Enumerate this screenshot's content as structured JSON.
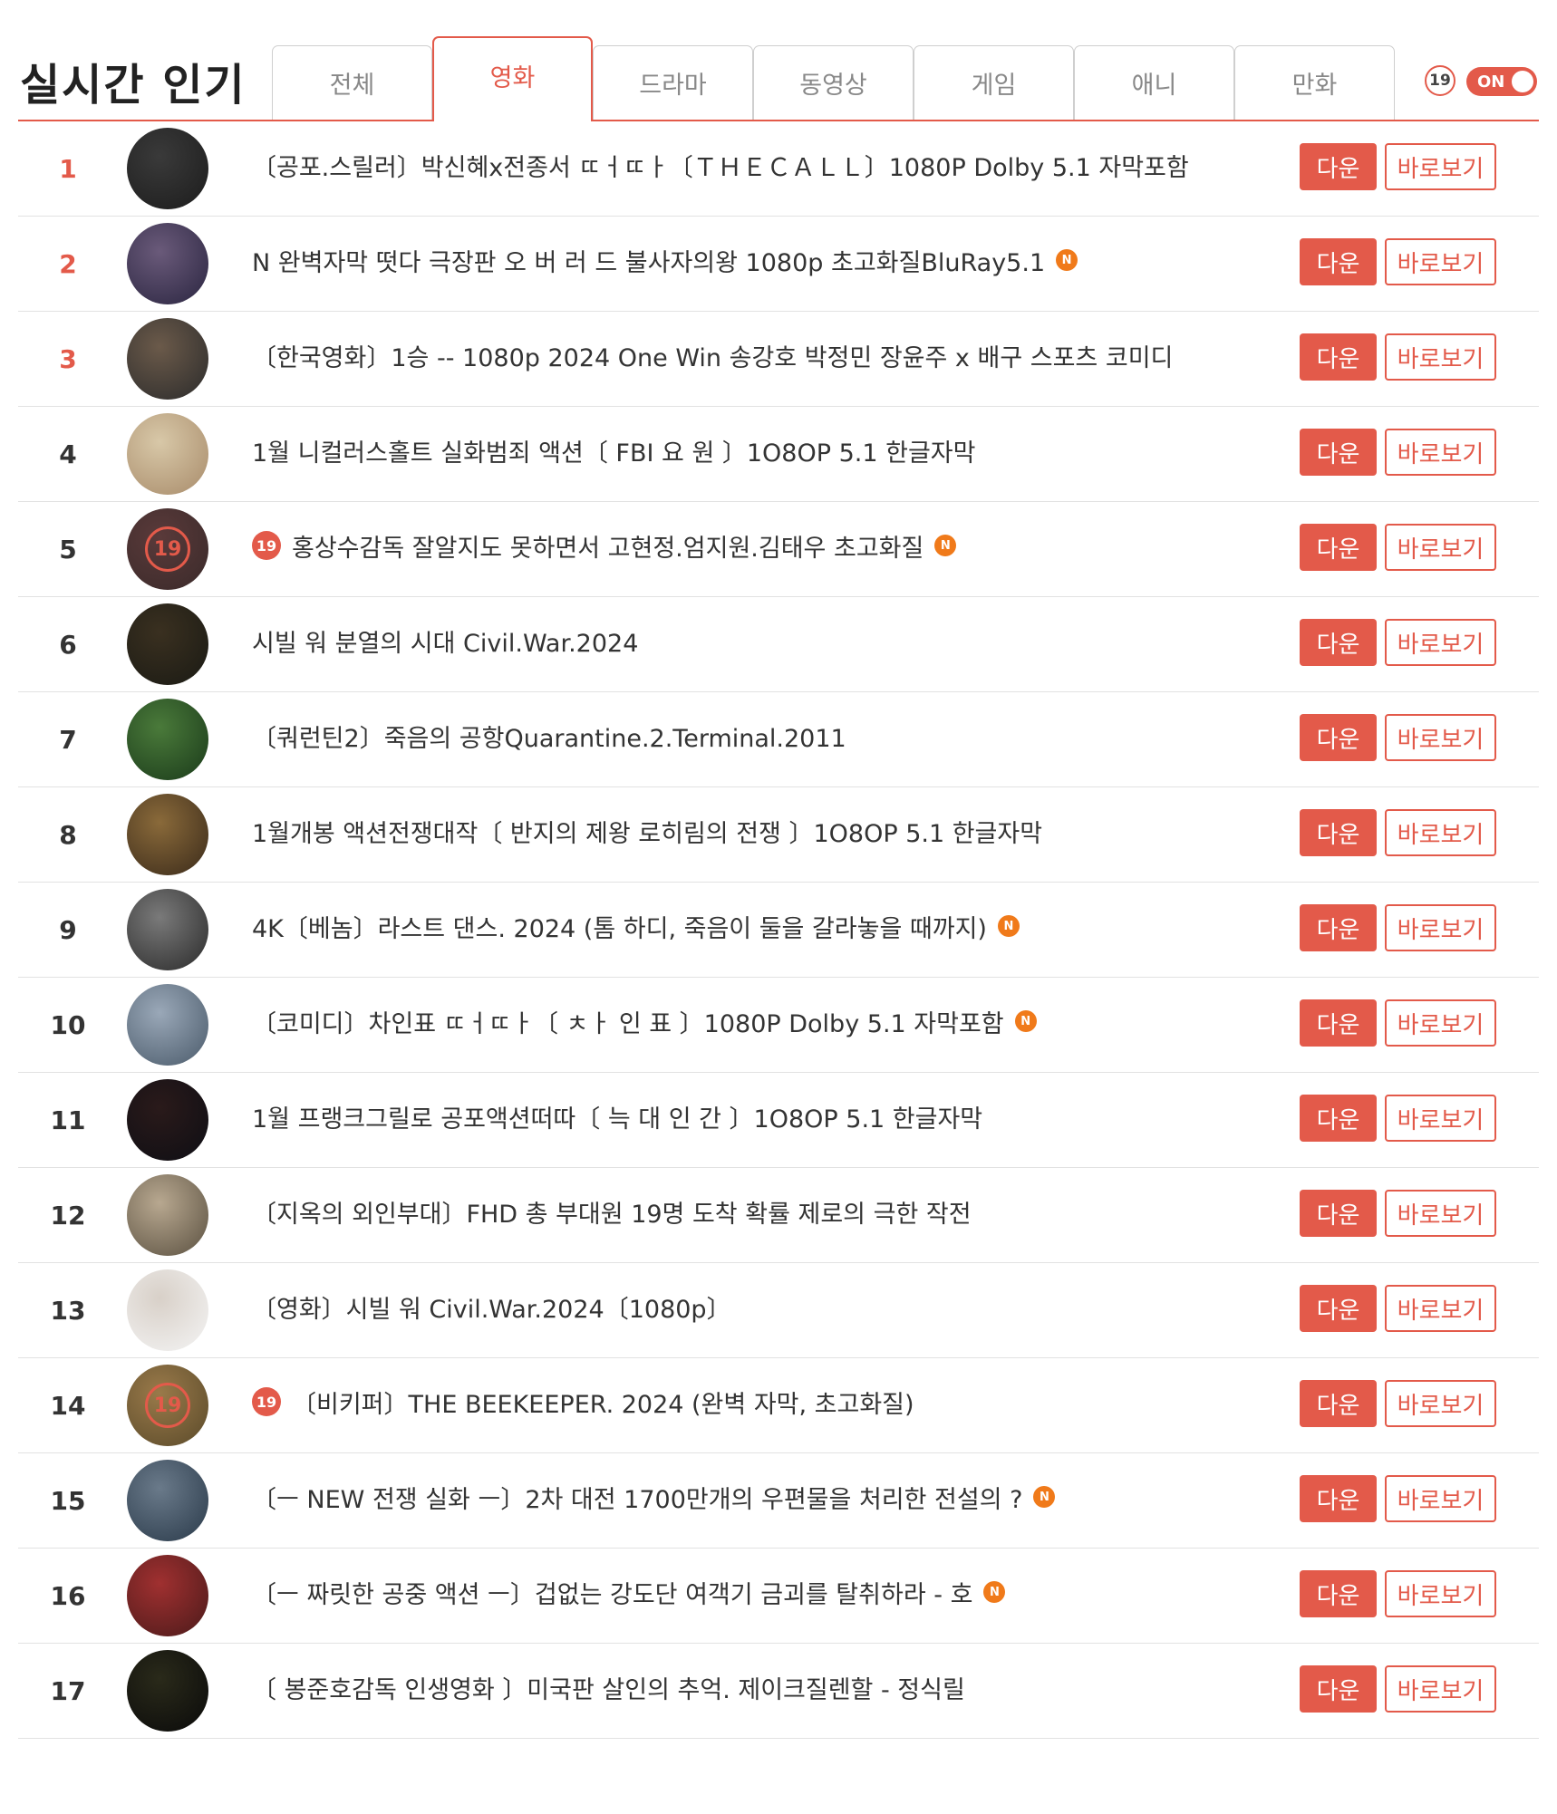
{
  "header": {
    "title": "실시간 인기",
    "adult_badge": "19",
    "toggle_label": "ON",
    "tabs": [
      {
        "label": "전체",
        "active": false
      },
      {
        "label": "영화",
        "active": true
      },
      {
        "label": "드라마",
        "active": false
      },
      {
        "label": "동영상",
        "active": false
      },
      {
        "label": "게임",
        "active": false
      },
      {
        "label": "애니",
        "active": false
      },
      {
        "label": "만화",
        "active": false
      }
    ]
  },
  "buttons": {
    "download": "다운",
    "view": "바로보기"
  },
  "colors": {
    "accent": "#e35a4a",
    "new_badge": "#f07a1a"
  },
  "items": [
    {
      "rank": "1",
      "title": "〔공포.스릴러〕박신혜x전종서 ㄸㅓㄸㅏ〔ＴＨＥＣＡＬＬ〕1080P Dolby 5.1 자막포함",
      "adult": false,
      "new": false,
      "thumb": [
        "#1c1c1c",
        "#3a3a3a"
      ]
    },
    {
      "rank": "2",
      "title": "N 완벽자막 떳다 극장판 오 버 러 드 불사자의왕 1080p 초고화질BluRay5.1",
      "adult": false,
      "new": true,
      "thumb": [
        "#2a2540",
        "#6a5a7a"
      ]
    },
    {
      "rank": "3",
      "title": "〔한국영화〕1승 -- 1080p 2024 One Win 송강호 박정민 장윤주 x 배구 스포츠 코미디",
      "adult": false,
      "new": false,
      "thumb": [
        "#2b2b2b",
        "#6b5a4a"
      ]
    },
    {
      "rank": "4",
      "title": "1월 니컬러스홀트 실화범죄 액션〔 FBI 요 원 〕1O8OP 5.1 한글자막",
      "adult": false,
      "new": false,
      "thumb": [
        "#a88b6a",
        "#d8c8a8"
      ]
    },
    {
      "rank": "5",
      "title": "홍상수감독 잘알지도 못하면서 고현정.엄지원.김태우 초고화질",
      "adult": true,
      "new": true,
      "thumb": [
        "#3a2a2a",
        "#5a3a3a"
      ]
    },
    {
      "rank": "6",
      "title": "시빌 워 분열의 시대 Civil.War.2024",
      "adult": false,
      "new": false,
      "thumb": [
        "#1a1a14",
        "#3a3020"
      ]
    },
    {
      "rank": "7",
      "title": "〔쿼런틴2〕죽음의 공항Quarantine.2.Terminal.2011",
      "adult": false,
      "new": false,
      "thumb": [
        "#1a3a1a",
        "#4a7a3a"
      ]
    },
    {
      "rank": "8",
      "title": "1월개봉 액션전쟁대작〔 반지의 제왕 로히림의 전쟁 〕1O8OP 5.1 한글자막",
      "adult": false,
      "new": false,
      "thumb": [
        "#3a2a1a",
        "#8a6a3a"
      ]
    },
    {
      "rank": "9",
      "title": "4K〔베놈〕라스트 댄스. 2024 (톰 하디, 죽음이 둘을 갈라놓을 때까지)",
      "adult": false,
      "new": true,
      "thumb": [
        "#2a2a2a",
        "#7a7a7a"
      ]
    },
    {
      "rank": "10",
      "title": "〔코미디〕차인표 ㄸㅓㄸㅏ〔 ㅊㅏ 인 표 〕1080P Dolby 5.1 자막포함",
      "adult": false,
      "new": true,
      "thumb": [
        "#4a5a6a",
        "#9aa8b8"
      ]
    },
    {
      "rank": "11",
      "title": "1월 프랭크그릴로 공포액션떠따〔 늑 대 인 간 〕1O8OP 5.1 한글자막",
      "adult": false,
      "new": false,
      "thumb": [
        "#0e0e14",
        "#2a1a1a"
      ]
    },
    {
      "rank": "12",
      "title": "〔지옥의 외인부대〕FHD 총 부대원 19명 도착 확률 제로의 극한 작전",
      "adult": false,
      "new": false,
      "thumb": [
        "#5a5040",
        "#b8a890"
      ]
    },
    {
      "rank": "13",
      "title": "〔영화〕시빌 워 Civil.War.2024〔1080p〕",
      "adult": false,
      "new": false,
      "thumb": [
        "#f4f4f4",
        "#d8d0c8"
      ]
    },
    {
      "rank": "14",
      "title": "〔비키퍼〕THE BEEKEEPER. 2024 (완벽 자막, 초고화질)",
      "adult": true,
      "new": false,
      "thumb": [
        "#5a4a2a",
        "#9a7a4a"
      ]
    },
    {
      "rank": "15",
      "title": "〔ㅡ NEW 전쟁 실화 ㅡ〕2차 대전 1700만개의 우편물을 처리한 전설의 ?",
      "adult": false,
      "new": true,
      "thumb": [
        "#2a3a4a",
        "#6a7a8a"
      ]
    },
    {
      "rank": "16",
      "title": "〔ㅡ 짜릿한 공중 액션 ㅡ〕겁없는 강도단 여객기 금괴를 탈취하라 - 호",
      "adult": false,
      "new": true,
      "thumb": [
        "#4a1a1a",
        "#a03030"
      ]
    },
    {
      "rank": "17",
      "title": "〔 봉준호감독 인생영화 〕미국판 살인의 추억. 제이크질렌할 - 정식릴",
      "adult": false,
      "new": false,
      "thumb": [
        "#0a0a0a",
        "#2a2a1a"
      ]
    }
  ]
}
